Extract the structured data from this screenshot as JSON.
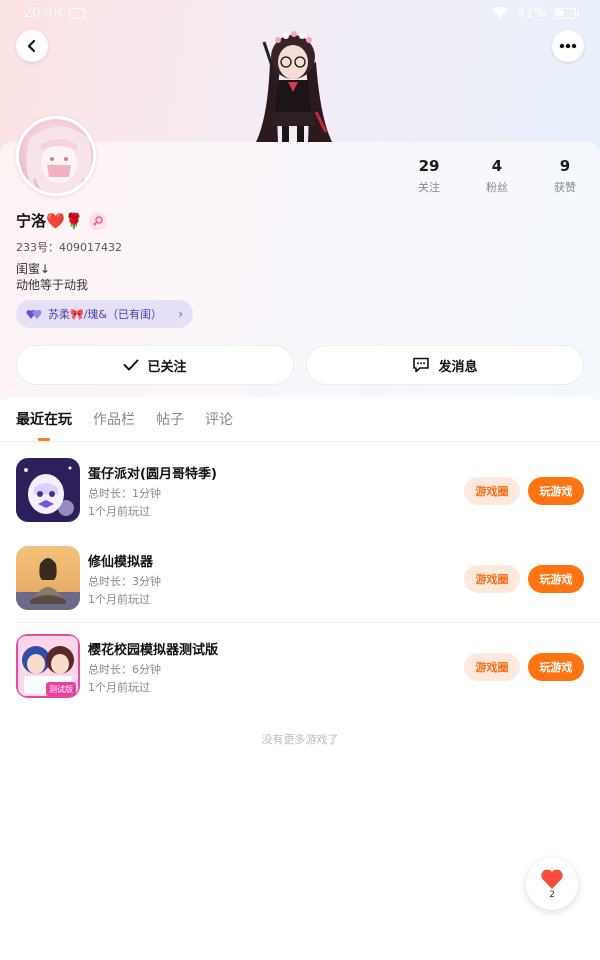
{
  "status_bar": {
    "time": "20:48",
    "battery": "41%",
    "battery_level": 0.41
  },
  "profile": {
    "username": "宁洛❤️🌹",
    "uid": "233号：409017432",
    "bio_line1": "闺蜜↓",
    "bio_line2": "动他等于动我",
    "relation_chip": "苏柔🎀/瑰&（已有闺）"
  },
  "stats": [
    {
      "value": "29",
      "label": "关注"
    },
    {
      "value": "4",
      "label": "粉丝"
    },
    {
      "value": "9",
      "label": "获赞"
    }
  ],
  "actions": {
    "follow_label": "已关注",
    "message_label": "发消息"
  },
  "tabs": [
    {
      "label": "最近在玩",
      "active": true
    },
    {
      "label": "作品栏",
      "active": false
    },
    {
      "label": "帖子",
      "active": false
    },
    {
      "label": "评论",
      "active": false
    }
  ],
  "games": [
    {
      "title": "蛋仔派对(圆月哥特季)",
      "duration": "总时长：1分钟",
      "last_played": "1个月前玩过",
      "circle_label": "游戏圈",
      "play_label": "玩游戏"
    },
    {
      "title": "修仙模拟器",
      "duration": "总时长：3分钟",
      "last_played": "1个月前玩过",
      "circle_label": "游戏圈",
      "play_label": "玩游戏"
    },
    {
      "title": "樱花校园模拟器测试版",
      "duration": "总时长：6分钟",
      "last_played": "1个月前玩过",
      "circle_label": "游戏圈",
      "play_label": "玩游戏"
    }
  ],
  "game_icon_badge": "测试版",
  "footer_text": "没有更多游戏了",
  "like_fab": {
    "count": "2"
  },
  "colors": {
    "accent": "#ff7412",
    "circle_bg": "#fde9dc",
    "chip_bg": "#e6e0f6"
  }
}
